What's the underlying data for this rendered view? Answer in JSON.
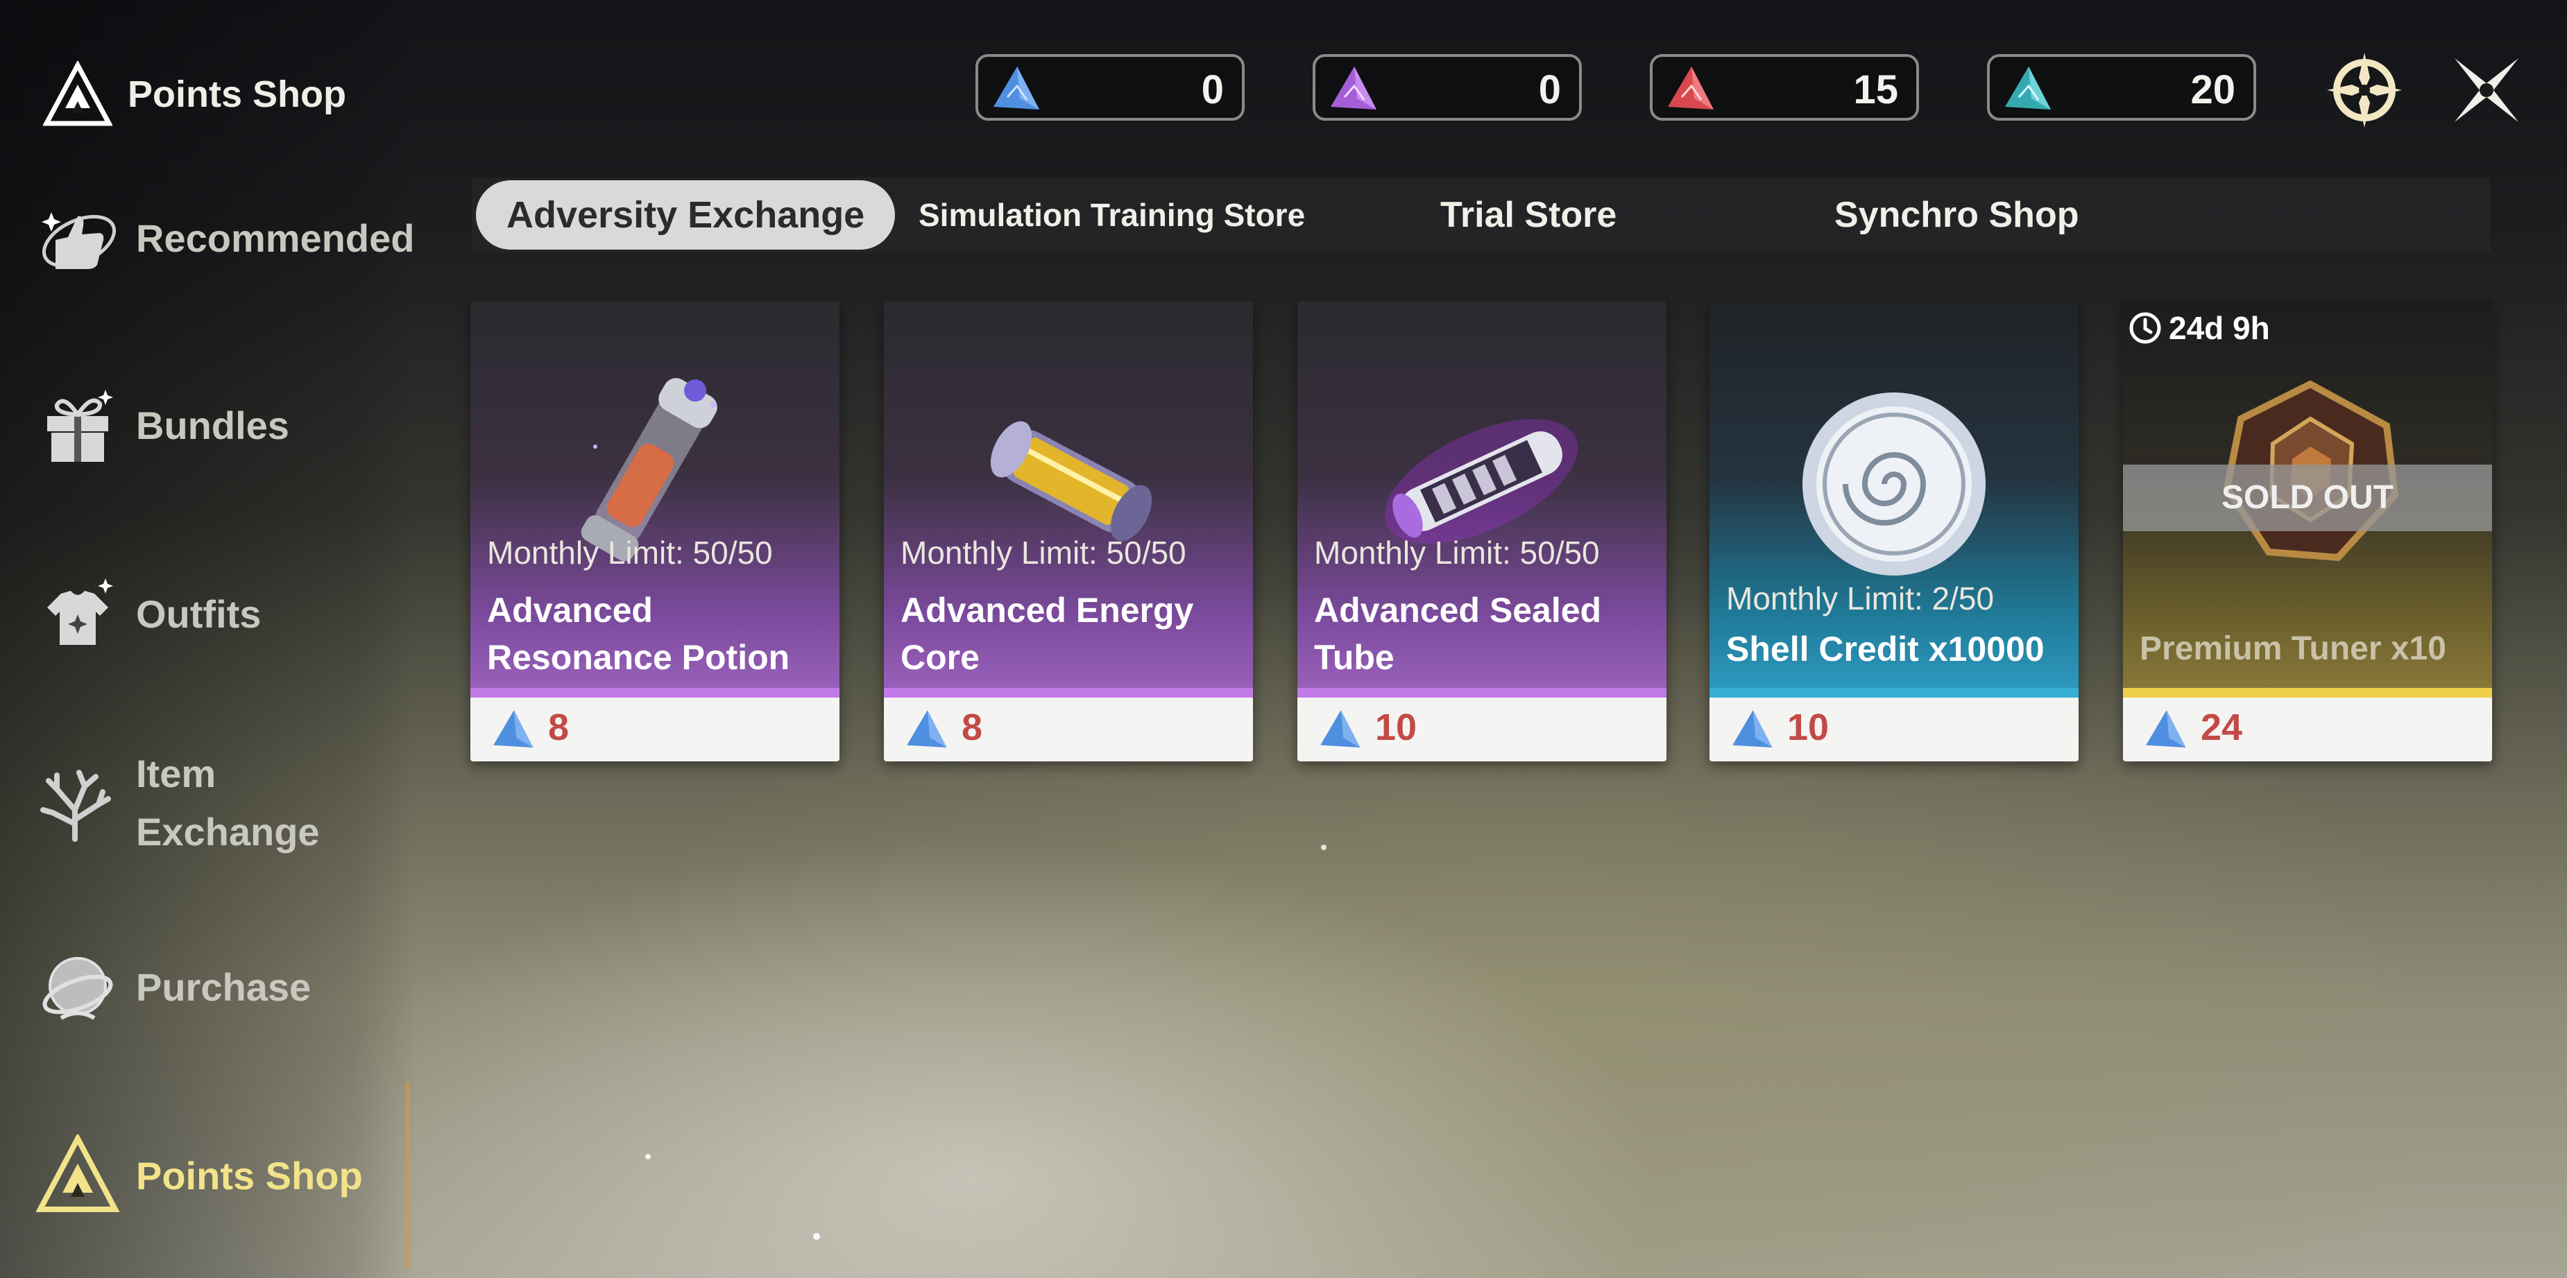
{
  "sidebar": {
    "title": "Points Shop",
    "items": [
      {
        "label": "Recommended",
        "icon": "recommended-icon"
      },
      {
        "label": "Bundles",
        "icon": "gift-icon"
      },
      {
        "label": "Outfits",
        "icon": "outfit-icon"
      },
      {
        "label": "Item Exchange",
        "icon": "coral-icon"
      },
      {
        "label": "Purchase",
        "icon": "orb-icon"
      },
      {
        "label": "Points Shop",
        "icon": "points-shop-icon",
        "active": true
      }
    ]
  },
  "currencies": [
    {
      "value": "0",
      "color": "#4f8fe0",
      "icon": "blue-triangle-icon"
    },
    {
      "value": "0",
      "color": "#b46be0",
      "icon": "purple-triangle-icon"
    },
    {
      "value": "15",
      "color": "#e05a5a",
      "icon": "red-triangle-icon"
    },
    {
      "value": "20",
      "color": "#46c2c8",
      "icon": "teal-triangle-icon"
    }
  ],
  "top_buttons": {
    "settings": "compass-icon",
    "close": "close-icon"
  },
  "tabs": [
    {
      "label": "Adversity Exchange",
      "active": true
    },
    {
      "label": "Simulation Training Store"
    },
    {
      "label": "Trial Store"
    },
    {
      "label": "Synchro Shop"
    }
  ],
  "items": [
    {
      "limit": "Monthly Limit: 50/50",
      "name": "Advanced Resonance Potion",
      "name_l1": "Advanced",
      "name_l2": "Resonance Potion",
      "price": "8",
      "rarity_color": "#b06fd8",
      "icon": "potion-vial-icon"
    },
    {
      "limit": "Monthly Limit: 50/50",
      "name": "Advanced Energy Core",
      "name_l1": "Advanced Energy",
      "name_l2": "Core",
      "price": "8",
      "rarity_color": "#b06fd8",
      "icon": "energy-core-icon"
    },
    {
      "limit": "Monthly Limit: 50/50",
      "name": "Advanced Sealed Tube",
      "name_l1": "Advanced Sealed",
      "name_l2": "Tube",
      "price": "10",
      "rarity_color": "#b06fd8",
      "icon": "sealed-tube-icon"
    },
    {
      "limit": "Monthly Limit: 2/50",
      "name": "Shell Credit x10000",
      "price": "10",
      "rarity_color": "#39a9c8",
      "icon": "shell-credit-icon"
    },
    {
      "timer": "24d 9h",
      "status": "SOLD OUT",
      "name": "Premium Tuner x10",
      "price": "24",
      "rarity_color": "#e8c94a",
      "icon": "tuner-icon"
    }
  ]
}
